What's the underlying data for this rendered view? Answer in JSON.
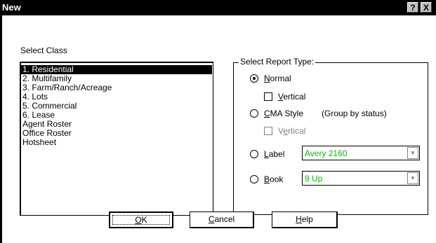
{
  "window": {
    "title": "New",
    "help_btn": "?",
    "close_btn": "X"
  },
  "class_select": {
    "label": "Select Class",
    "items": [
      {
        "label": "1. Residential",
        "selected": true
      },
      {
        "label": "2. Multifamily",
        "selected": false
      },
      {
        "label": "3. Farm/Ranch/Acreage",
        "selected": false
      },
      {
        "label": "4. Lots",
        "selected": false
      },
      {
        "label": "5. Commercial",
        "selected": false
      },
      {
        "label": "6. Lease",
        "selected": false
      },
      {
        "label": "Agent Roster",
        "selected": false
      },
      {
        "label": "Office Roster",
        "selected": false
      },
      {
        "label": "Hotsheet",
        "selected": false
      }
    ]
  },
  "report_type": {
    "label": "Select Report Type:",
    "normal": {
      "prefix": "",
      "mnemonic": "N",
      "rest": "ormal",
      "checked": true
    },
    "normal_vertical": {
      "mnemonic": "V",
      "rest": "ertical",
      "checked": false,
      "enabled": true
    },
    "cma": {
      "prefix": "",
      "mnemonic": "C",
      "rest": "MA Style",
      "note": "(Group by status)",
      "checked": false
    },
    "cma_vertical": {
      "prefix": "V",
      "mnemonic": "e",
      "rest": "rtical",
      "checked": false,
      "enabled": false
    },
    "label_opt": {
      "prefix": "",
      "mnemonic": "L",
      "rest": "abel",
      "checked": false,
      "value": "Avery 2160"
    },
    "book_opt": {
      "prefix": "",
      "mnemonic": "B",
      "rest": "ook",
      "checked": false,
      "value": "9 Up"
    }
  },
  "buttons": {
    "ok": {
      "mnemonic": "O",
      "rest": "K"
    },
    "cancel": {
      "mnemonic": "C",
      "rest": "ancel"
    },
    "help": {
      "mnemonic": "H",
      "rest": "elp"
    }
  },
  "colors": {
    "combo_text": "#00c000",
    "selection_bg": "#000000",
    "title_bg": "#000000"
  }
}
